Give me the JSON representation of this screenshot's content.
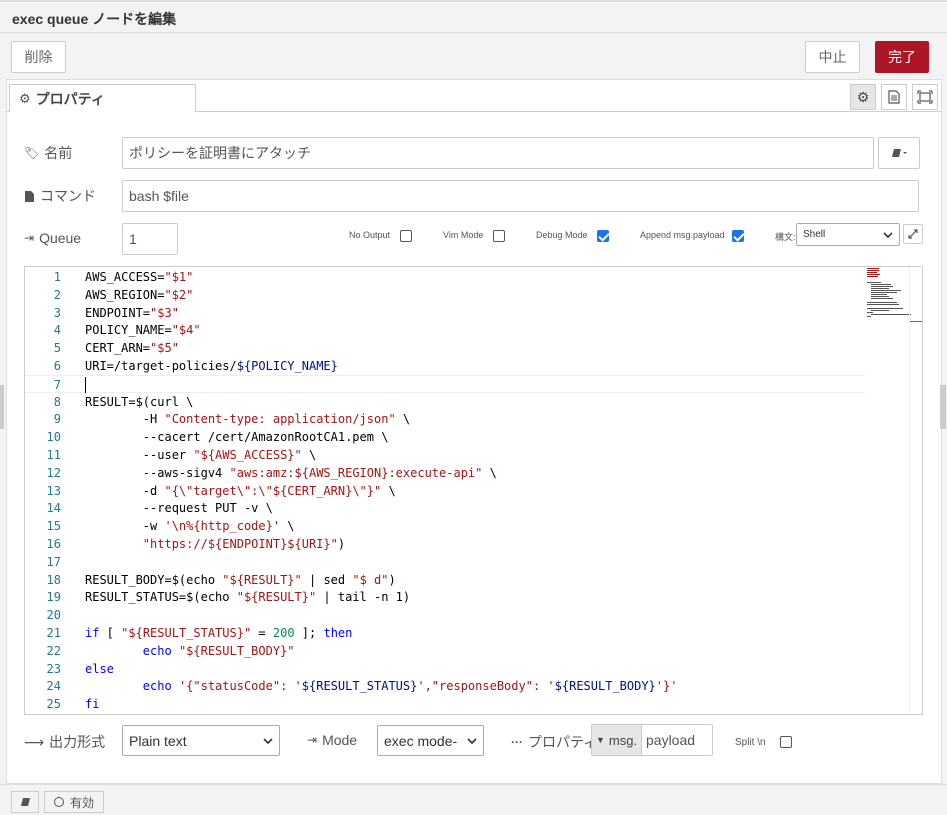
{
  "header": {
    "title": "exec queue ノードを編集"
  },
  "toolbar": {
    "delete_label": "削除",
    "cancel_label": "中止",
    "done_label": "完了"
  },
  "tabs": {
    "properties_label": "プロパティ"
  },
  "form": {
    "name_label": "名前",
    "name_value": "ポリシーを証明書にアタッチ",
    "command_label": "コマンド",
    "command_value": "bash $file",
    "queue_label": "Queue",
    "queue_value": "1",
    "no_output_label": "No Output",
    "no_output_checked": false,
    "vim_mode_label": "Vim Mode",
    "vim_mode_checked": false,
    "debug_mode_label": "Debug Mode",
    "debug_mode_checked": true,
    "append_label": "Append msg.payload",
    "append_checked": true,
    "syntax_label": "構文:",
    "syntax_value": "Shell",
    "output_format_label": "出力形式",
    "output_format_value": "Plain text",
    "mode_label": "Mode",
    "mode_value": "exec mode-",
    "property_label": "プロパティ",
    "property_prefix": "msg.",
    "property_value": "payload",
    "split_label": "Split \\n",
    "split_checked": false
  },
  "footer": {
    "enabled_label": "有効"
  },
  "colors": {
    "primary": "#ad1625",
    "line_number": "#237893",
    "string": "#a31515",
    "keyword": "#0000ff",
    "variable": "#001080"
  },
  "code": [
    [
      "1",
      [
        [
          "AWS_ACCESS=",
          ""
        ],
        [
          "\"$1\"",
          "str"
        ]
      ]
    ],
    [
      "2",
      [
        [
          "AWS_REGION=",
          ""
        ],
        [
          "\"$2\"",
          "str"
        ]
      ]
    ],
    [
      "3",
      [
        [
          "ENDPOINT=",
          ""
        ],
        [
          "\"$3\"",
          "str"
        ]
      ]
    ],
    [
      "4",
      [
        [
          "POLICY_NAME=",
          ""
        ],
        [
          "\"$4\"",
          "str"
        ]
      ]
    ],
    [
      "5",
      [
        [
          "CERT_ARN=",
          ""
        ],
        [
          "\"$5\"",
          "str"
        ]
      ]
    ],
    [
      "6",
      [
        [
          "URI=/target-policies/",
          ""
        ],
        [
          "${POLICY_NAME}",
          "var"
        ]
      ]
    ],
    [
      "7",
      []
    ],
    [
      "8",
      [
        [
          "RESULT=$(curl \\",
          ""
        ]
      ]
    ],
    [
      "9",
      [
        [
          "        -H ",
          ""
        ],
        [
          "\"Content-type: application/json\"",
          "str"
        ],
        [
          " \\",
          ""
        ]
      ]
    ],
    [
      "10",
      [
        [
          "        --cacert /cert/AmazonRootCA1.pem \\",
          ""
        ]
      ]
    ],
    [
      "11",
      [
        [
          "        --user ",
          ""
        ],
        [
          "\"${AWS_ACCESS}\"",
          "str"
        ],
        [
          " \\",
          ""
        ]
      ]
    ],
    [
      "12",
      [
        [
          "        --aws-sigv4 ",
          ""
        ],
        [
          "\"aws:amz:${AWS_REGION}:execute-api\"",
          "str"
        ],
        [
          " \\",
          ""
        ]
      ]
    ],
    [
      "13",
      [
        [
          "        -d ",
          ""
        ],
        [
          "\"{\\\"target\\\":\\\"${CERT_ARN}\\\"}\"",
          "str"
        ],
        [
          " \\",
          ""
        ]
      ]
    ],
    [
      "14",
      [
        [
          "        --request PUT -v \\",
          ""
        ]
      ]
    ],
    [
      "15",
      [
        [
          "        -w ",
          ""
        ],
        [
          "'\\n%{http_code}'",
          "str"
        ],
        [
          " \\",
          ""
        ]
      ]
    ],
    [
      "16",
      [
        [
          "        ",
          ""
        ],
        [
          "\"https://${ENDPOINT}${URI}\"",
          "str"
        ],
        [
          ")",
          ""
        ]
      ]
    ],
    [
      "17",
      []
    ],
    [
      "18",
      [
        [
          "RESULT_BODY=$(echo ",
          ""
        ],
        [
          "\"${RESULT}\"",
          "str"
        ],
        [
          " | sed ",
          ""
        ],
        [
          "\"$ d\"",
          "str"
        ],
        [
          ")",
          ""
        ]
      ]
    ],
    [
      "19",
      [
        [
          "RESULT_STATUS=$(echo ",
          ""
        ],
        [
          "\"${RESULT}\"",
          "str"
        ],
        [
          " | tail -n 1)",
          ""
        ]
      ]
    ],
    [
      "20",
      []
    ],
    [
      "21",
      [
        [
          "if",
          "kw"
        ],
        [
          " [ ",
          ""
        ],
        [
          "\"${RESULT_STATUS}\"",
          "str"
        ],
        [
          " = ",
          ""
        ],
        [
          "200",
          "num"
        ],
        [
          " ]; ",
          ""
        ],
        [
          "then",
          "kw"
        ]
      ]
    ],
    [
      "22",
      [
        [
          "        ",
          ""
        ],
        [
          "echo",
          "kw"
        ],
        [
          " ",
          ""
        ],
        [
          "\"${RESULT_BODY}\"",
          "str"
        ]
      ]
    ],
    [
      "23",
      [
        [
          "else",
          "kw"
        ]
      ]
    ],
    [
      "24",
      [
        [
          "        ",
          ""
        ],
        [
          "echo",
          "kw"
        ],
        [
          " ",
          ""
        ],
        [
          "'{\"statusCode\": '",
          "str"
        ],
        [
          "${RESULT_STATUS}",
          "var"
        ],
        [
          "',\"responseBody\": '",
          "str"
        ],
        [
          "${RESULT_BODY}",
          "var"
        ],
        [
          "'}'",
          "str"
        ]
      ]
    ],
    [
      "25",
      [
        [
          "fi",
          "kw"
        ]
      ]
    ]
  ]
}
